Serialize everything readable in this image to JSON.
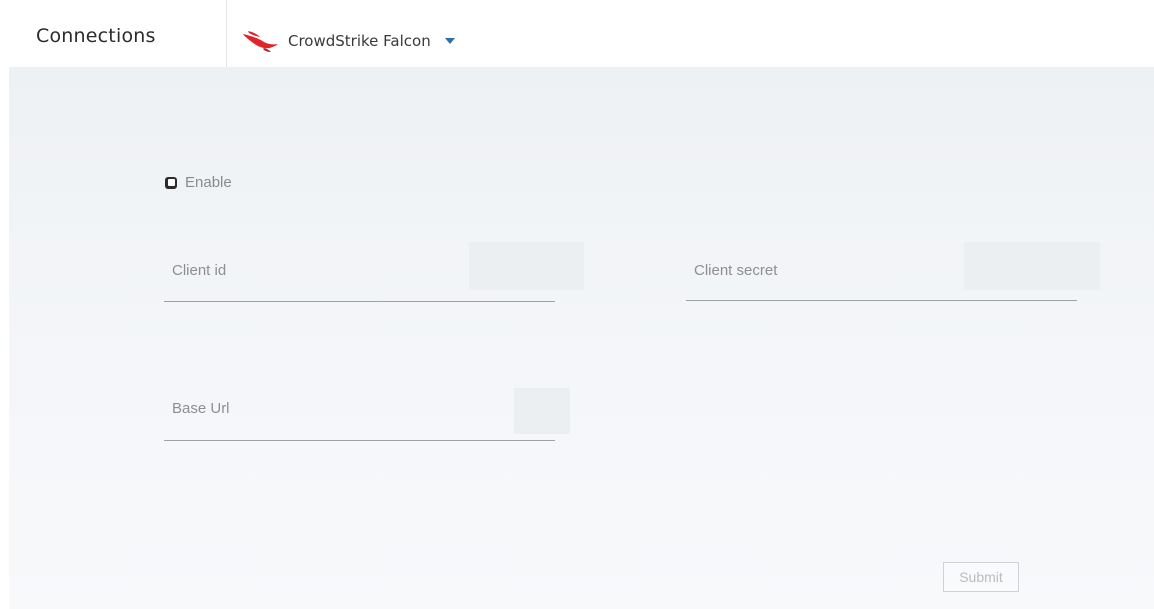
{
  "header": {
    "title": "Connections",
    "provider": {
      "name": "CrowdStrike Falcon",
      "logo_icon": "crowdstrike-falcon-icon",
      "logo_color": "#e0242a",
      "caret_icon": "caret-down-icon",
      "caret_color": "#2f6ea5"
    }
  },
  "form": {
    "enable": {
      "label": "Enable",
      "checked": true
    },
    "client_id": {
      "placeholder": "Client id",
      "value": ""
    },
    "client_secret": {
      "placeholder": "Client secret",
      "value": ""
    },
    "base_url": {
      "placeholder": "Base Url",
      "value": ""
    },
    "submit_label": "Submit"
  }
}
